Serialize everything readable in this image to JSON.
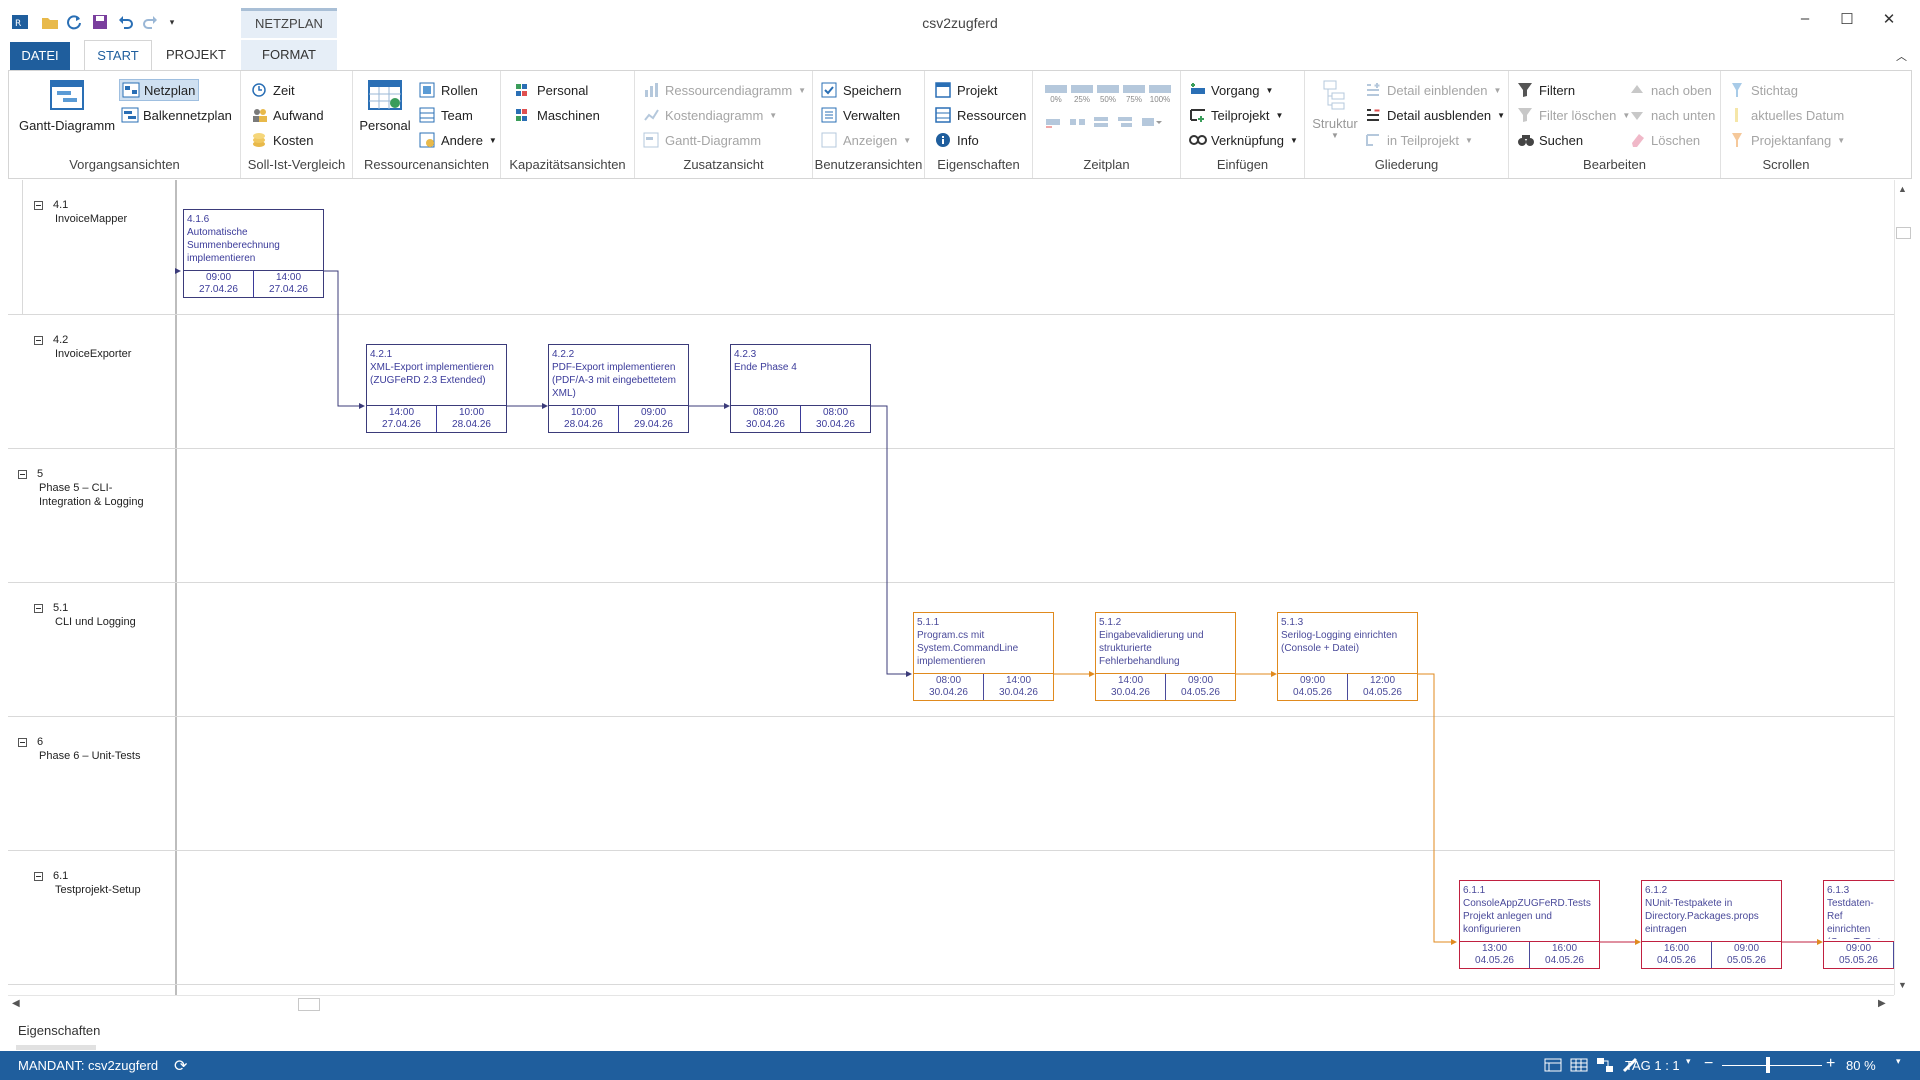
{
  "window": {
    "title": "csv2zugferd"
  },
  "qat": {
    "icons": [
      "app-icon",
      "open-icon",
      "refresh-icon",
      "save-icon",
      "undo-icon",
      "redo-icon",
      "customize-icon"
    ]
  },
  "tabs": {
    "datei": "DATEI",
    "start": "START",
    "projekt": "PROJEKT",
    "context_header": "NETZPLAN",
    "format": "FORMAT"
  },
  "ribbon": {
    "vorgang": {
      "gantt": "Gantt-Diagramm",
      "netzplan": "Netzplan",
      "balken": "Balkennetzplan",
      "label": "Vorgangsansichten"
    },
    "sollist": {
      "zeit": "Zeit",
      "aufwand": "Aufwand",
      "kosten": "Kosten",
      "label": "Soll-Ist-Vergleich"
    },
    "ressourcen": {
      "personal": "Personal",
      "rollen": "Rollen",
      "team": "Team",
      "andere": "Andere",
      "label": "Ressourcenansichten"
    },
    "kapazitaet": {
      "personal": "Personal",
      "maschinen": "Maschinen",
      "label": "Kapazitätsansichten"
    },
    "zusatz": {
      "ressdiag": "Ressourcendiagramm",
      "kostdiag": "Kostendiagramm",
      "gantt": "Gantt-Diagramm",
      "label": "Zusatzansicht"
    },
    "benutzer": {
      "speichern": "Speichern",
      "verwalten": "Verwalten",
      "anzeigen": "Anzeigen",
      "label": "Benutzeransichten"
    },
    "eigenschaften": {
      "projekt": "Projekt",
      "ressourcen": "Ressourcen",
      "info": "Info",
      "label": "Eigenschaften"
    },
    "zeitplan": {
      "p0": "0%",
      "p25": "25%",
      "p50": "50%",
      "p75": "75%",
      "p100": "100%",
      "label": "Zeitplan"
    },
    "einfuegen": {
      "vorgang": "Vorgang",
      "teilprojekt": "Teilprojekt",
      "verknuepfung": "Verknüpfung",
      "label": "Einfügen"
    },
    "gliederung": {
      "struktur": "Struktur",
      "einblenden": "Detail einblenden",
      "ausblenden": "Detail ausblenden",
      "inteil": "in Teilprojekt",
      "label": "Gliederung"
    },
    "bearbeiten": {
      "filtern": "Filtern",
      "filterloeschen": "Filter löschen",
      "suchen": "Suchen",
      "oben": "nach oben",
      "unten": "nach unten",
      "loeschen": "Löschen",
      "label": "Bearbeiten"
    },
    "scrollen": {
      "stichtag": "Stichtag",
      "datum": "aktuelles Datum",
      "anfang": "Projektanfang",
      "label": "Scrollen"
    }
  },
  "rows": [
    {
      "id": "4.1",
      "name": "InvoiceMapper"
    },
    {
      "id": "4.2",
      "name": "InvoiceExporter"
    },
    {
      "id": "5",
      "name": "Phase 5 – CLI-Integration & Logging"
    },
    {
      "id": "5.1",
      "name": "CLI und Logging"
    },
    {
      "id": "6",
      "name": "Phase 6 – Unit-Tests"
    },
    {
      "id": "6.1",
      "name": "Testprojekt-Setup"
    }
  ],
  "nodes": [
    {
      "id": "4.1.6",
      "title": "Automatische Summenberechnung implementieren",
      "start_time": "09:00",
      "start_date": "27.04.26",
      "end_time": "14:00",
      "end_date": "27.04.26"
    },
    {
      "id": "4.2.1",
      "title": "XML-Export implementieren (ZUGFeRD 2.3 Extended)",
      "start_time": "14:00",
      "start_date": "27.04.26",
      "end_time": "10:00",
      "end_date": "28.04.26"
    },
    {
      "id": "4.2.2",
      "title": "PDF-Export implementieren (PDF/A-3 mit eingebettetem XML)",
      "start_time": "10:00",
      "start_date": "28.04.26",
      "end_time": "09:00",
      "end_date": "29.04.26"
    },
    {
      "id": "4.2.3",
      "title": "Ende Phase 4",
      "start_time": "08:00",
      "start_date": "30.04.26",
      "end_time": "08:00",
      "end_date": "30.04.26"
    },
    {
      "id": "5.1.1",
      "title": "Program.cs mit System.CommandLine implementieren",
      "start_time": "08:00",
      "start_date": "30.04.26",
      "end_time": "14:00",
      "end_date": "30.04.26"
    },
    {
      "id": "5.1.2",
      "title": "Eingabevalidierung und strukturierte Fehlerbehandlung",
      "start_time": "14:00",
      "start_date": "30.04.26",
      "end_time": "09:00",
      "end_date": "04.05.26"
    },
    {
      "id": "5.1.3",
      "title": "Serilog-Logging einrichten (Console + Datei)",
      "start_time": "09:00",
      "start_date": "04.05.26",
      "end_time": "12:00",
      "end_date": "04.05.26"
    },
    {
      "id": "6.1.1",
      "title": "ConsoleAppZUGFeRD.Tests Projekt anlegen und konfigurieren",
      "start_time": "13:00",
      "start_date": "04.05.26",
      "end_time": "16:00",
      "end_date": "04.05.26"
    },
    {
      "id": "6.1.2",
      "title": "NUnit-Testpakete in Directory.Packages.props eintragen",
      "start_time": "16:00",
      "start_date": "04.05.26",
      "end_time": "09:00",
      "end_date": "05.05.26"
    },
    {
      "id": "6.1.3",
      "title": "Testdaten-Ref einrichten (CopyToOutp",
      "start_time": "09:00",
      "start_date": "05.05.26",
      "end_time": "",
      "end_date": ""
    }
  ],
  "properties": {
    "title": "Eigenschaften"
  },
  "status": {
    "mandant": "MANDANT: csv2zugferd",
    "scale": "TAG 1 : 1",
    "zoom": "80 %"
  },
  "colors": {
    "accent": "#1f5e9d",
    "blue_node": "#3b3b7a",
    "orange_node": "#e08a1e",
    "red_node": "#c02040"
  }
}
